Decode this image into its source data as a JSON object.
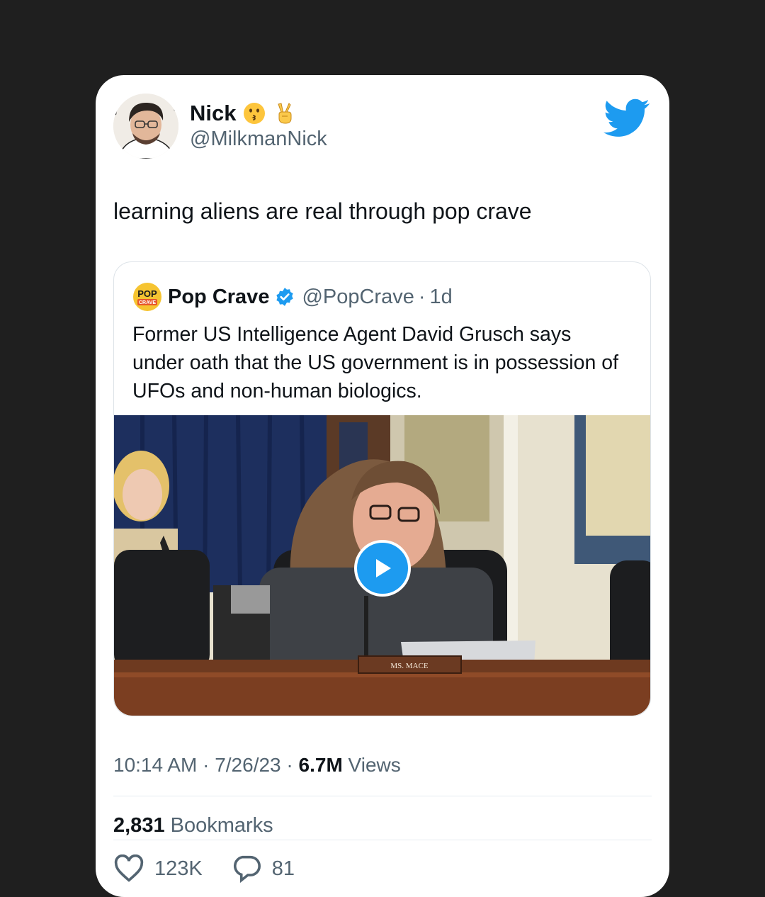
{
  "tweet": {
    "author_name": "Nick",
    "author_handle": "@MilkmanNick",
    "text": "learning aliens are real through pop crave",
    "timestamp": "10:14 AM",
    "date": "7/26/23",
    "views_count": "6.7M",
    "views_label": "Views",
    "bookmarks_count": "2,831",
    "bookmarks_label": "Bookmarks",
    "likes_count": "123K",
    "replies_count": "81",
    "name_emojis": [
      "kissing-face-emoji",
      "victory-hand-emoji"
    ]
  },
  "quoted_tweet": {
    "author_name": "Pop Crave",
    "author_handle": "@PopCrave",
    "age": "1d",
    "text": "Former US Intelligence Agent David Grusch says under oath that the US government is in possession of UFOs and non-human biologics.",
    "logo_text_top": "POP",
    "logo_text_bottom": "CRAVE",
    "media": {
      "type": "video",
      "nameplate": "MS. MACE"
    }
  },
  "icons": {
    "brand": "twitter-bird-icon",
    "verified": "verified-badge-icon",
    "play": "play-icon",
    "like": "heart-icon",
    "reply": "reply-icon"
  },
  "colors": {
    "background": "#1f1f1f",
    "card": "#ffffff",
    "brand_blue": "#1d9bf0",
    "text_primary": "#0f1419",
    "text_secondary": "#536471"
  }
}
